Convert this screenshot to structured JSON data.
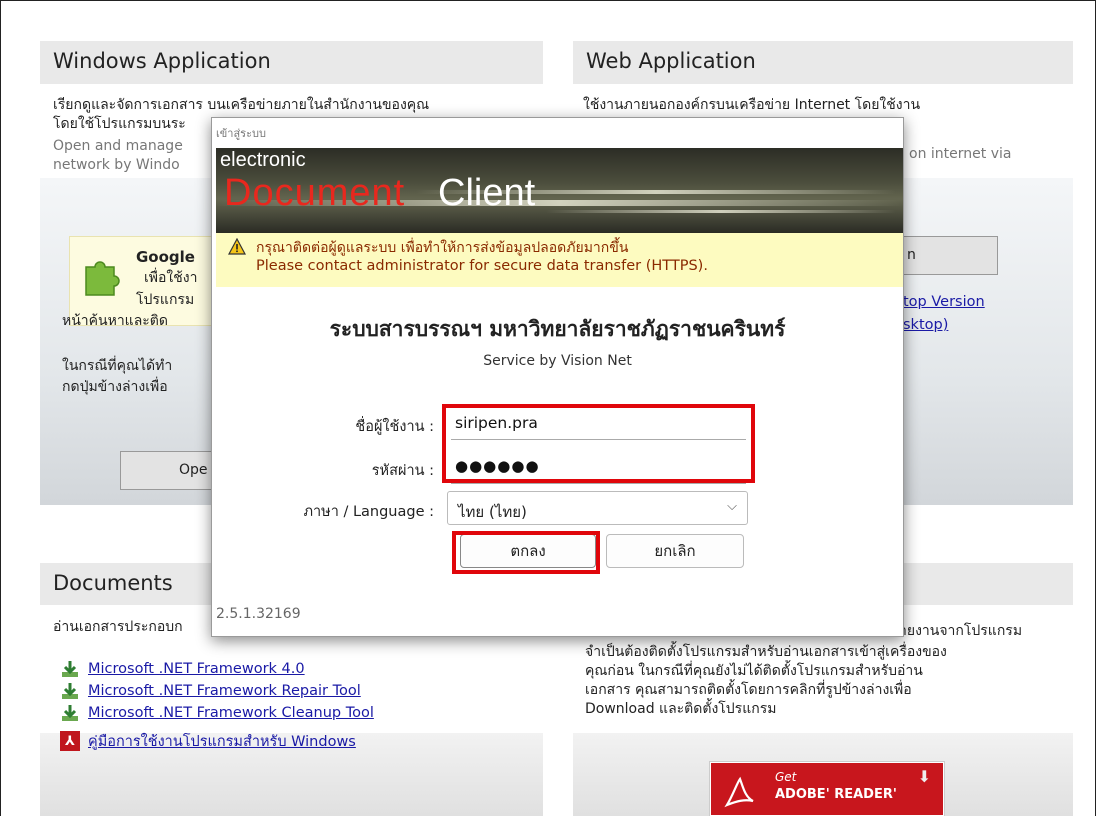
{
  "windows_app": {
    "header": "Windows Application",
    "line1": "เรียกดูและจัดการเอกสาร บนเครือข่ายภายในสำนักงานของคุณ",
    "line2": "โดยใช้โปรแกรมบนระ",
    "line3": "Open and manage",
    "line4": "network by Windo",
    "google_title": "Google",
    "google_l1": "เพื่อใช้งา",
    "google_l2": "โปรแกรม",
    "google_l3": "หน้าค้นหาและติด",
    "note_l1": "ในกรณีที่คุณได้ทำ",
    "note_l2": "กดปุ่มข้างล่างเพื่อ",
    "open_button": "Ope"
  },
  "web_app": {
    "header": "Web Application",
    "line1": "ใช้งานภายนอกองค์กรบนเครือข่าย Internet โดยใช้งาน",
    "line3": "on internet via",
    "button_label": "n",
    "desktop_l1": "top Version",
    "desktop_l2": "sktop)"
  },
  "documents": {
    "header": "Documents",
    "intro": "อ่านเอกสารประกอบก",
    "links": [
      "Microsoft .NET Framework 4.0",
      "Microsoft .NET Framework Repair Tool",
      "Microsoft .NET Framework Cleanup Tool",
      "คู่มือการใช้งานโปรแกรมสำหรับ Windows"
    ]
  },
  "reader": {
    "l0": "ายงานจากโปรแกรม",
    "l1": "จำเป็นต้องติดตั้งโปรแกรมสำหรับอ่านเอกสารเข้าสู่เครื่องของ",
    "l2": "คุณก่อน ในกรณีที่คุณยังไม่ได้ติดตั้งโปรแกรมสำหรับอ่าน",
    "l3": "เอกสาร คุณสามารถติดตั้งโดยการคลิกที่รูปข้างล่างเพื่อ",
    "l4": "Download และติดตั้งโปรแกรม",
    "adobe_get": "Get",
    "adobe_name": "ADOBE' READER'"
  },
  "modal": {
    "title": "เข้าสู่ระบบ",
    "banner_electronic": "electronic",
    "banner_document": "Document",
    "banner_client": "Client",
    "warning_th": "กรุณาติดต่อผู้ดูแลระบบ เพื่อทำให้การส่งข้อมูลปลอดภัยมากขึ้น",
    "warning_en": "Please contact administrator for secure data transfer (HTTPS).",
    "system_title": "ระบบสารบรรณฯ มหาวิทยาลัยราชภัฏราชนครินทร์",
    "service": "Service by Vision Net",
    "username_label": "ชื่อผู้ใช้งาน :",
    "username_value": "siripen.pra",
    "password_label": "รหัสผ่าน :",
    "password_value": "●●●●●●",
    "language_label": "ภาษา / Language :",
    "language_value": "ไทย (ไทย)",
    "ok_button": "ตกลง",
    "cancel_button": "ยกเลิก",
    "version": "2.5.1.32169"
  },
  "colors": {
    "highlight": "#e0060b",
    "warning_bg": "#fdfbc0",
    "link": "#1a1aa6"
  }
}
